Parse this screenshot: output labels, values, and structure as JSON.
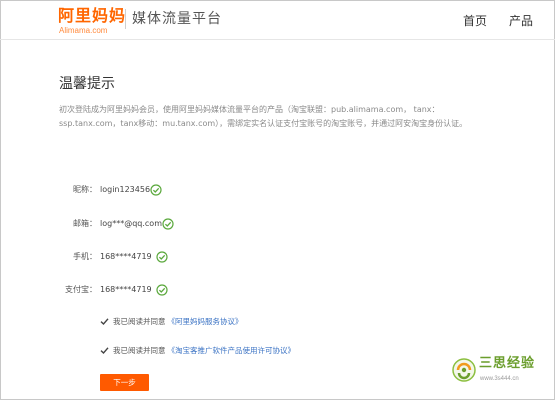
{
  "header": {
    "logo_text": "阿里妈妈",
    "logo_sub": "Alimama.com",
    "platform_title": "媒体流量平台",
    "nav": {
      "home": "首页",
      "product": "产品"
    }
  },
  "main": {
    "title": "温馨提示",
    "notice": "初次登陆成为阿里妈妈会员，使用阿里妈妈媒体流量平台的产品（淘宝联盟：pub.alimama.com， tanx：ssp.tanx.com，tanx移动：mu.tanx.com），需绑定实名认证支付宝账号的淘宝账号，并通过阿安淘宝身份认证。",
    "fields": [
      {
        "label": "昵称：",
        "value": "login123456"
      },
      {
        "label": "邮箱：",
        "value": "log***@qq.com"
      },
      {
        "label": "手机：",
        "value": "168****4719"
      },
      {
        "label": "支付宝：",
        "value": "168****4719"
      }
    ],
    "agreements": [
      {
        "text": "我已阅读并同意",
        "link": "《阿里妈妈服务协议》"
      },
      {
        "text": "我已阅读并同意",
        "link": "《淘宝客推广软件产品使用许可协议》"
      }
    ],
    "next_button": "下一步"
  },
  "watermark": {
    "name": "三思经验",
    "url": "www.3s444.cn"
  },
  "colors": {
    "brand_orange": "#ff6600",
    "button": "#ff5a00",
    "check_green": "#5aa83c",
    "link_blue": "#3b73c4"
  }
}
